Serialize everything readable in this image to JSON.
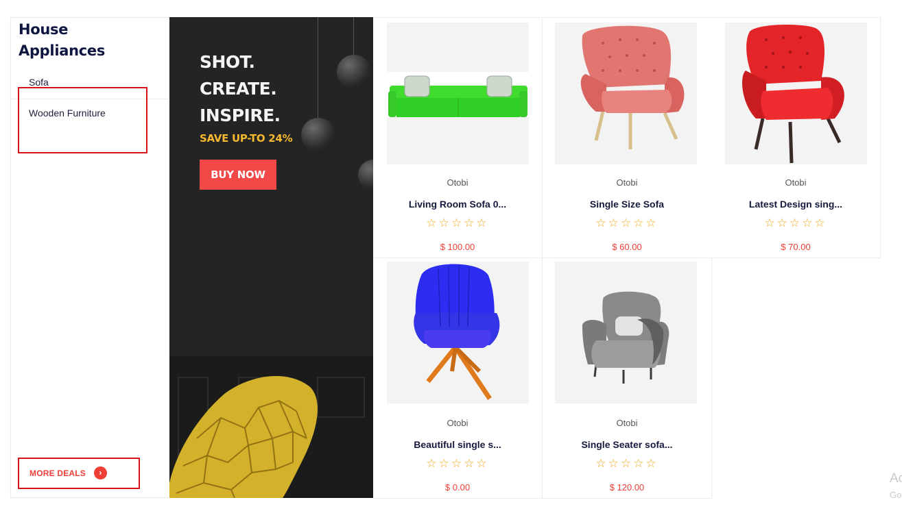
{
  "category_panel": {
    "title": "House Appliances",
    "items": [
      {
        "label": "Sofa"
      },
      {
        "label": "Wooden Furniture"
      }
    ],
    "more_deals_label": "MORE DEALS",
    "more_deals_icon": "arrow-right-circle-icon"
  },
  "banner": {
    "headline_lines": [
      "SHOT.",
      "CREATE.",
      "INSPIRE."
    ],
    "subline": "SAVE UP-TO 24%",
    "button_label": "BUY NOW",
    "colors": {
      "accent": "#f5b82e",
      "button": "#f24848",
      "background": "#242424"
    }
  },
  "products": [
    {
      "brand": "Otobi",
      "name": "Living Room Sofa 0...",
      "rating": 0,
      "price": "$ 100.00",
      "image": "green-sofa"
    },
    {
      "brand": "Otobi",
      "name": "Single Size Sofa",
      "rating": 0,
      "price": "$ 60.00",
      "image": "pink-armchair"
    },
    {
      "brand": "Otobi",
      "name": "Latest Design sing...",
      "rating": 0,
      "price": "$ 70.00",
      "image": "red-wingback-chair"
    },
    {
      "brand": "Otobi",
      "name": "Beautiful single s...",
      "rating": 0,
      "price": "$ 0.00",
      "image": "blue-chair"
    },
    {
      "brand": "Otobi",
      "name": "Single Seater sofa...",
      "rating": 0,
      "price": "$ 120.00",
      "image": "grey-armchair"
    }
  ],
  "watermark": {
    "line1": "Ac",
    "line2": "Go"
  },
  "colors": {
    "price": "#ef3e36",
    "stars": "#f0a81b",
    "highlight": "#d6111a"
  }
}
